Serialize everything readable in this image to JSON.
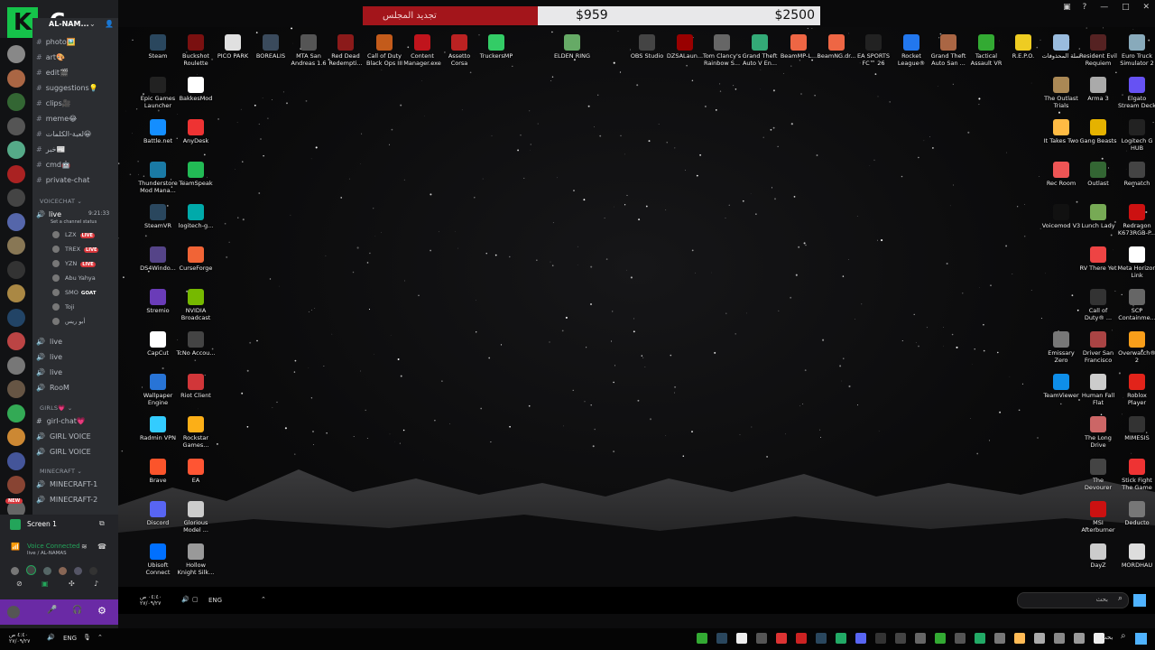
{
  "topbar": {
    "goal_label": "تجديد المجلس",
    "current": "$959",
    "target": "$2500"
  },
  "discord": {
    "server_name": "AL-NAM...",
    "logo_letter": "K",
    "logo_number": "6",
    "channels": [
      {
        "name": "photo🖼️",
        "icon": "#"
      },
      {
        "name": "art🎨",
        "icon": "#"
      },
      {
        "name": "edit🎬",
        "icon": "#"
      },
      {
        "name": "suggestions💡",
        "icon": "#"
      },
      {
        "name": "clips🎥",
        "icon": "#"
      },
      {
        "name": "meme😂",
        "icon": "#"
      },
      {
        "name": "لعبة-الكلمات😀",
        "icon": "#"
      },
      {
        "name": "خبر📰",
        "icon": "#"
      },
      {
        "name": "cmd🤖",
        "icon": "#"
      },
      {
        "name": "private-chat",
        "icon": "#"
      }
    ],
    "voicechat_cat": "VOICECHAT",
    "live_channel": "live",
    "live_time": "9:21:33",
    "status_placeholder": "Set a channel status",
    "voice_users": [
      {
        "name": "LZX",
        "live": true
      },
      {
        "name": "TREX",
        "live": true
      },
      {
        "name": "YZN",
        "live": true
      },
      {
        "name": "Abu Yahya",
        "live": false
      },
      {
        "name": "SMO",
        "goat": "GOAT"
      },
      {
        "name": "Toji",
        "live": false
      },
      {
        "name": "أبو ريس",
        "live": false
      }
    ],
    "live_label": "LIVE",
    "more_voice": [
      "live",
      "live",
      "live",
      "RooM"
    ],
    "girls_cat": "GIRLS💗",
    "girls_channels": [
      "girl-chat💗",
      "GIRL VOICE",
      "GIRL VOICE"
    ],
    "minecraft_cat": "MINECRAFT",
    "minecraft_channels": [
      "MINECRAFT-1",
      "MINECRAFT-2"
    ],
    "screen_label": "Screen 1",
    "voice_connected": "Voice Connected",
    "voice_sub": "live / AL-NAMAS",
    "new_badge": "NEW"
  },
  "desktop_icons": [
    {
      "label": "Steam",
      "color": "#2a475e"
    },
    {
      "label": "Buckshot Roulette",
      "color": "#7a1010"
    },
    {
      "label": "PICO PARK",
      "color": "#e0e0e0"
    },
    {
      "label": "BOREALIS",
      "color": "#3a4a5c"
    },
    {
      "label": "MTA San Andreas 1.6",
      "color": "#555"
    },
    {
      "label": "Red Dead Redempti...",
      "color": "#8b1a1a"
    },
    {
      "label": "Call of Duty Black Ops III",
      "color": "#c35b1b"
    },
    {
      "label": "Content Manager.exe",
      "color": "#c0141c"
    },
    {
      "label": "Assetto Corsa",
      "color": "#b22"
    },
    {
      "label": "TruckersMP",
      "color": "#3c6"
    },
    {
      "label": "ELDEN RING",
      "color": "#6a6"
    },
    {
      "label": "OBS Studio",
      "color": "#444"
    },
    {
      "label": "DZSALaun...",
      "color": "#900"
    },
    {
      "label": "Tom Clancy's Rainbow S...",
      "color": "#666"
    },
    {
      "label": "Grand Theft Auto V En...",
      "color": "#3a7"
    },
    {
      "label": "BeamMP-L...",
      "color": "#e64"
    },
    {
      "label": "BeamNG.dr...",
      "color": "#e64"
    },
    {
      "label": "EA SPORTS FC™ 26",
      "color": "#222"
    },
    {
      "label": "Rocket League®",
      "color": "#27e"
    },
    {
      "label": "Grand Theft Auto San ...",
      "color": "#a64"
    },
    {
      "label": "Tactical Assault VR",
      "color": "#3a3"
    },
    {
      "label": "R.E.P.O.",
      "color": "#ec2"
    },
    {
      "label": "سلة المحذوفات",
      "color": "#9bd"
    },
    {
      "label": "Resident Evil Requiem",
      "color": "#522"
    },
    {
      "label": "Euro Truck Simulator 2",
      "color": "#8ab"
    },
    {
      "label": "Epic Games Launcher",
      "color": "#222"
    },
    {
      "label": "BakkesMod",
      "color": "#fff"
    },
    {
      "label": "Battle.net",
      "color": "#148eff"
    },
    {
      "label": "AnyDesk",
      "color": "#e33"
    },
    {
      "label": "Thunderstore Mod Mana...",
      "color": "#1a7aa5"
    },
    {
      "label": "TeamSpeak",
      "color": "#2b5"
    },
    {
      "label": "SteamVR",
      "color": "#2a475e"
    },
    {
      "label": "logitech-g...",
      "color": "#0aa"
    },
    {
      "label": "DS4Windo...",
      "color": "#548"
    },
    {
      "label": "CurseForge",
      "color": "#f16436"
    },
    {
      "label": "Stremio",
      "color": "#6a3cb8"
    },
    {
      "label": "NVIDIA Broadcast",
      "color": "#76b900"
    },
    {
      "label": "CapCut",
      "color": "#fff"
    },
    {
      "label": "TcNo Accou...",
      "color": "#444"
    },
    {
      "label": "Wallpaper Engine",
      "color": "#2874d6"
    },
    {
      "label": "Riot Client",
      "color": "#d13639"
    },
    {
      "label": "Radmin VPN",
      "color": "#3cf"
    },
    {
      "label": "Rockstar Games...",
      "color": "#fcaf17"
    },
    {
      "label": "Brave",
      "color": "#fb542b"
    },
    {
      "label": "EA",
      "color": "#f53"
    },
    {
      "label": "Discord",
      "color": "#5865f2"
    },
    {
      "label": "Glorious Model ...",
      "color": "#ccc"
    },
    {
      "label": "Ubisoft Connect",
      "color": "#0070ff"
    },
    {
      "label": "Hollow Knight Silk...",
      "color": "#999"
    },
    {
      "label": "The Outlast Trials",
      "color": "#a85"
    },
    {
      "label": "Arma 3",
      "color": "#aaa"
    },
    {
      "label": "Elgato Stream Deck",
      "color": "#6652f3"
    },
    {
      "label": "It Takes Two",
      "color": "#fb4"
    },
    {
      "label": "Gang Beasts",
      "color": "#e5b200"
    },
    {
      "label": "Logitech G HUB",
      "color": "#222"
    },
    {
      "label": "Rec Room",
      "color": "#e55"
    },
    {
      "label": "Outlast",
      "color": "#363"
    },
    {
      "label": "Rematch",
      "color": "#444"
    },
    {
      "label": "Voicemod V3",
      "color": "#111"
    },
    {
      "label": "Lunch Lady",
      "color": "#7a5"
    },
    {
      "label": "Redragon K673RGB-P...",
      "color": "#c11"
    },
    {
      "label": "RV There Yet",
      "color": "#e44"
    },
    {
      "label": "Meta Horizon Link",
      "color": "#fff"
    },
    {
      "label": "Call of Duty® ...",
      "color": "#333"
    },
    {
      "label": "SCP Containme...",
      "color": "#666"
    },
    {
      "label": "Emissary Zero",
      "color": "#777"
    },
    {
      "label": "Driver San Francisco",
      "color": "#a44"
    },
    {
      "label": "Overwatch® 2",
      "color": "#f99e1a"
    },
    {
      "label": "TeamViewer",
      "color": "#0e8ee9"
    },
    {
      "label": "Human Fall Flat",
      "color": "#ccc"
    },
    {
      "label": "Roblox Player",
      "color": "#e2231a"
    },
    {
      "label": "The Long Drive",
      "color": "#c66"
    },
    {
      "label": "MIMESIS",
      "color": "#333"
    },
    {
      "label": "The Devourer Hunted Souls",
      "color": "#444"
    },
    {
      "label": "Stick Fight The Game",
      "color": "#e33"
    },
    {
      "label": "MSI Afterburner",
      "color": "#c11"
    },
    {
      "label": "Deducto",
      "color": "#777"
    },
    {
      "label": "DayZ",
      "color": "#ccc"
    },
    {
      "label": "MORDHAU",
      "color": "#ddd"
    }
  ],
  "taskbar1": {
    "time": "٠٤:٤٠ ص",
    "date": "٢٧/٠٩/٢٧",
    "lang": "ENG",
    "search_placeholder": "بحث"
  },
  "taskbar2": {
    "time": "٤:٤٠ ص",
    "date": "٢٧/٠٩/٢٧",
    "lang": "ENG",
    "search_placeholder": "بحث"
  }
}
